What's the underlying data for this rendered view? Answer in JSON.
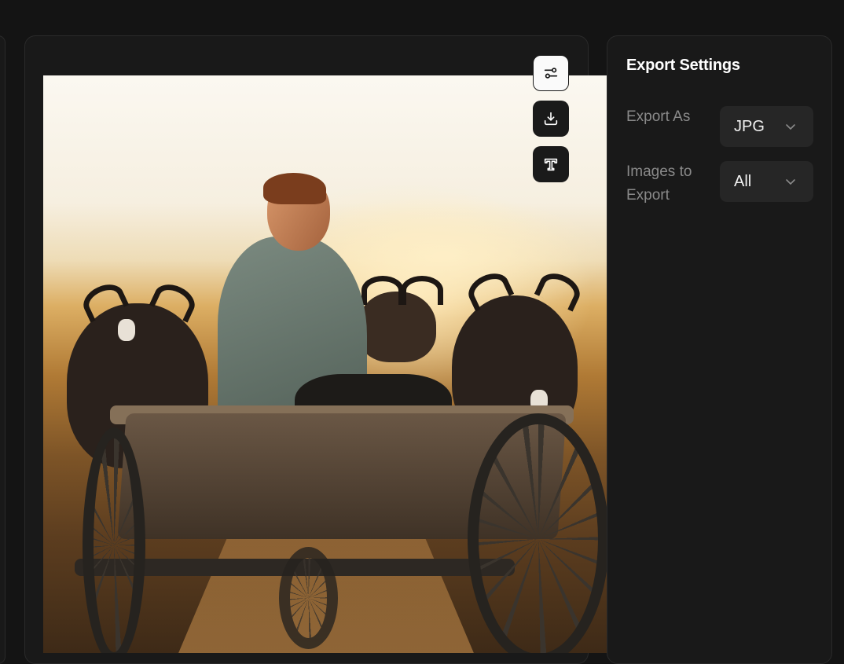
{
  "settings": {
    "title": "Export Settings",
    "export_as": {
      "label": "Export As",
      "value": "JPG"
    },
    "images_to_export": {
      "label": "Images to Export",
      "value": "All"
    }
  },
  "toolbar": {
    "icons": [
      "sliders-icon",
      "download-icon",
      "text-icon"
    ]
  },
  "colors": {
    "background": "#141414",
    "panel": "#191919",
    "select": "#262626",
    "label": "#8a8a8a"
  }
}
